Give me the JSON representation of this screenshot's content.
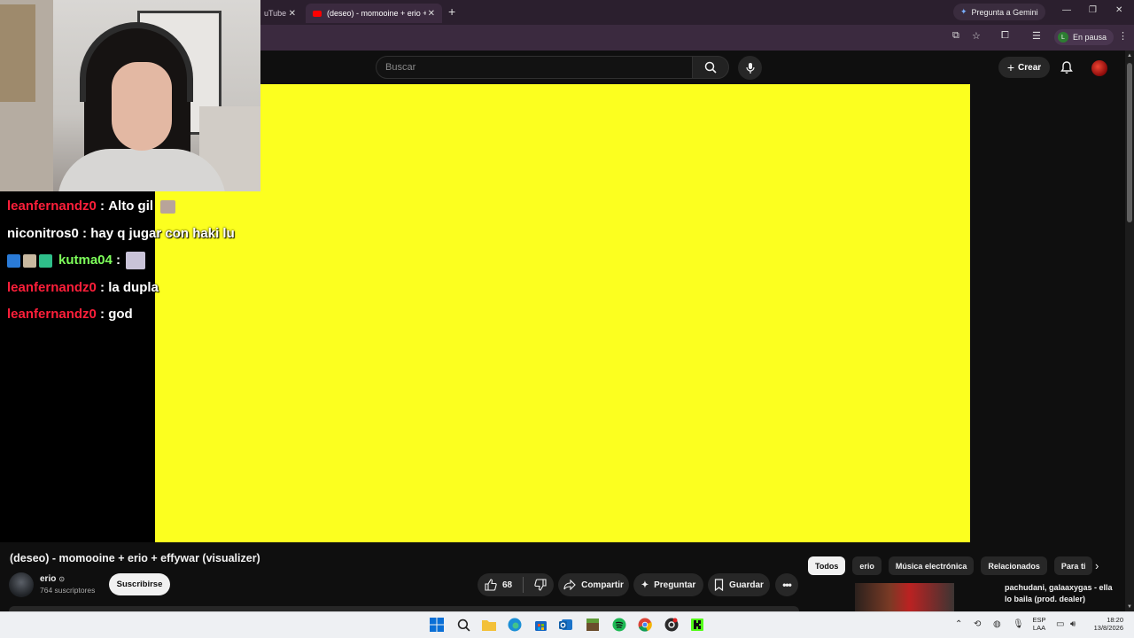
{
  "browser": {
    "tab1_title": "uTube",
    "tab2_title": "(deseo) - momooine + erio + e",
    "gemini_label": "Pregunta a Gemini",
    "profile_initial": "L",
    "profile_label": "En pausa"
  },
  "youtube": {
    "search_placeholder": "Buscar",
    "create_label": "Crear"
  },
  "chat": [
    {
      "user": "leanfernandz0",
      "sep": " : ",
      "msg": "Alto gil"
    },
    {
      "user": "niconitros0",
      "sep": " : ",
      "msg": "hay q jugar con haki lu"
    },
    {
      "user": "kutma04",
      "sep": " : ",
      "msg": ""
    },
    {
      "user": "leanfernandz0",
      "sep": " : ",
      "msg": "la dupla"
    },
    {
      "user": "leanfernandz0",
      "sep": " : ",
      "msg": "god"
    }
  ],
  "video": {
    "title": "(deseo) - momooine + erio + effywar (visualizer)",
    "channel": "erio",
    "subscribers": "764 suscriptores",
    "subscribe_label": "Suscribirse",
    "likes": "68",
    "share_label": "Compartir",
    "ask_label": "Preguntar",
    "save_label": "Guardar"
  },
  "chips": [
    "Todos",
    "erio",
    "Música electrónica",
    "Relacionados",
    "Para ti"
  ],
  "recommendation": {
    "title": "pachudani, galaaxygas - ella lo baila (prod. dealer)"
  },
  "taskbar": {
    "lang_top": "ESP",
    "lang_bottom": "LAA",
    "time": "18:20",
    "date": "13/8/2026"
  }
}
